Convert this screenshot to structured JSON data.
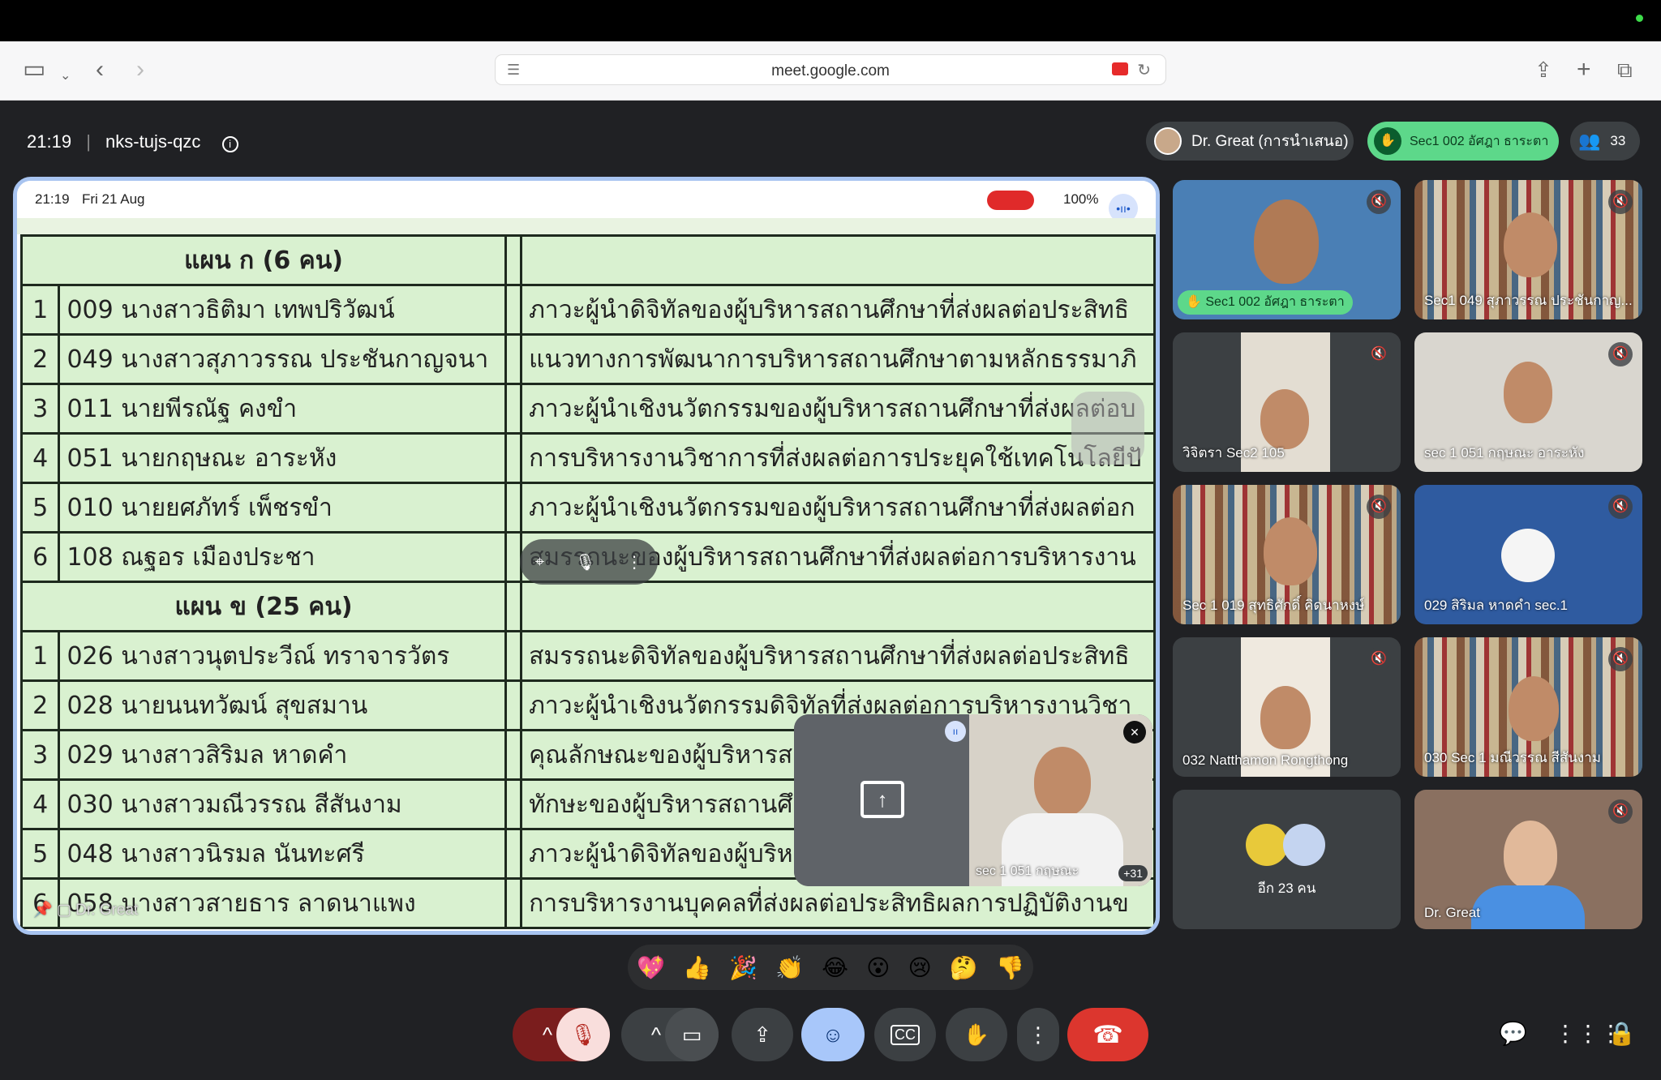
{
  "browser": {
    "url": "meet.google.com"
  },
  "meeting": {
    "time": "21:19",
    "code": "nks-tujs-qzc",
    "presenter_pill": "Dr. Great (การนำเสนอ)",
    "raised_hand_pill": "Sec1 002 อัศฎา ธาระตา",
    "participant_count": "33"
  },
  "ipad_status": {
    "time": "21:19",
    "date": "Fri 21 Aug",
    "battery": "100%"
  },
  "table": {
    "plan_a_header": "แผน ก (6 คน)",
    "plan_b_header": "แผน ข (25 คน)",
    "plan_a": [
      {
        "no": "1",
        "name": "009 นางสาวธิติมา เทพปริวัฒน์",
        "topic": "ภาวะผู้นำดิจิทัลของผู้บริหารสถานศึกษาที่ส่งผลต่อประสิทธิ",
        "red": false
      },
      {
        "no": "2",
        "name": "049 นางสาวสุภาวรรณ ประชันกาญจนา",
        "topic": "แนวทางการพัฒนาการบริหารสถานศึกษาตามหลักธรรมาภิ",
        "red": true
      },
      {
        "no": "3",
        "name": "011 นายพีรณัฐ คงขำ",
        "topic": "ภาวะผู้นำเชิงนวัตกรรมของผู้บริหารสถานศึกษาที่ส่งผลต่อบ",
        "red": false
      },
      {
        "no": "4",
        "name": "051 นายกฤษณะ อาระหัง",
        "topic": "การบริหารงานวิชาการที่ส่งผลต่อการประยุคใช้เทคโนโลยีปั",
        "red": true
      },
      {
        "no": "5",
        "name": "010 นายยศภัทร์ เพ็ชรขำ",
        "topic": "ภาวะผู้นำเชิงนวัตกรรมของผู้บริหารสถานศึกษาที่ส่งผลต่อก",
        "red": false
      },
      {
        "no": "6",
        "name": "108 ณฐอร เมืองประชา",
        "topic": "สมรรถนะของผู้บริหารสถานศึกษาที่ส่งผลต่อการบริหารงาน",
        "red": false
      }
    ],
    "plan_b": [
      {
        "no": "1",
        "name": "026 นางสาวนุตประวีณ์ ทราจารวัตร",
        "topic": "สมรรถนะดิจิทัลของผู้บริหารสถานศึกษาที่ส่งผลต่อประสิทธิ",
        "red": true
      },
      {
        "no": "2",
        "name": "028 นายนนทวัฒน์ สุขสมาน",
        "topic": "ภาวะผู้นำเชิงนวัตกรรมดิจิทัลที่ส่งผลต่อการบริหารงานวิชา",
        "red": true
      },
      {
        "no": "3",
        "name": "029 นางสาวสิริมล หาดคำ",
        "topic": "คุณลักษณะของผู้บริหารสถานศึกษาที่ส่งผลต่อการบริหารง",
        "red": true
      },
      {
        "no": "4",
        "name": "030 นางสาวมณีวรรณ สีสันงาม",
        "topic": "ทักษะของผู้บริหารสถานศึกษาที่ส่งผลต่อการบริหารงานด้",
        "red": true
      },
      {
        "no": "5",
        "name": "048 นางสาวนิรมล นันทะศรี",
        "topic": "ภาวะผู้นำดิจิทัลของผู้บริหารสถานศึกษาที่ส่งผลต่อประสิทธิ",
        "red": false
      },
      {
        "no": "6",
        "name": "058 นางสาวสายธาร ลาดนาแพง",
        "topic": "การบริหารงานบุคคลที่ส่งผลต่อประสิทธิผลการปฏิบัติงานข",
        "red": false
      }
    ]
  },
  "pip": {
    "self_label": "sec 1 051 กฤษณะ",
    "extra_count": "+31"
  },
  "presenter_tag": "Dr. Great",
  "tiles": [
    {
      "label": "Sec1 002 อัศฎา ธาระตา",
      "hand": true
    },
    {
      "label": "Sec1 049 สุภาวรรณ ประชันกาญ..."
    },
    {
      "label": "วิจิตรา Sec2 105"
    },
    {
      "label": "sec 1 051 กฤษณะ อาระหัง"
    },
    {
      "label": "Sec 1 019 สุทธิศักดิ์ คิดนาหงษ์"
    },
    {
      "label": "029 สิริมล หาดคำ sec.1"
    },
    {
      "label": "032 Natthamon Rongthong"
    },
    {
      "label": "030 Sec 1 มณีวรรณ สีสันงาม"
    },
    {
      "label": "อีก 23 คน"
    },
    {
      "label": "Dr. Great"
    }
  ],
  "reactions": [
    "💖",
    "👍",
    "🎉",
    "👏",
    "😂",
    "😮",
    "😢",
    "🤔",
    "👎"
  ]
}
